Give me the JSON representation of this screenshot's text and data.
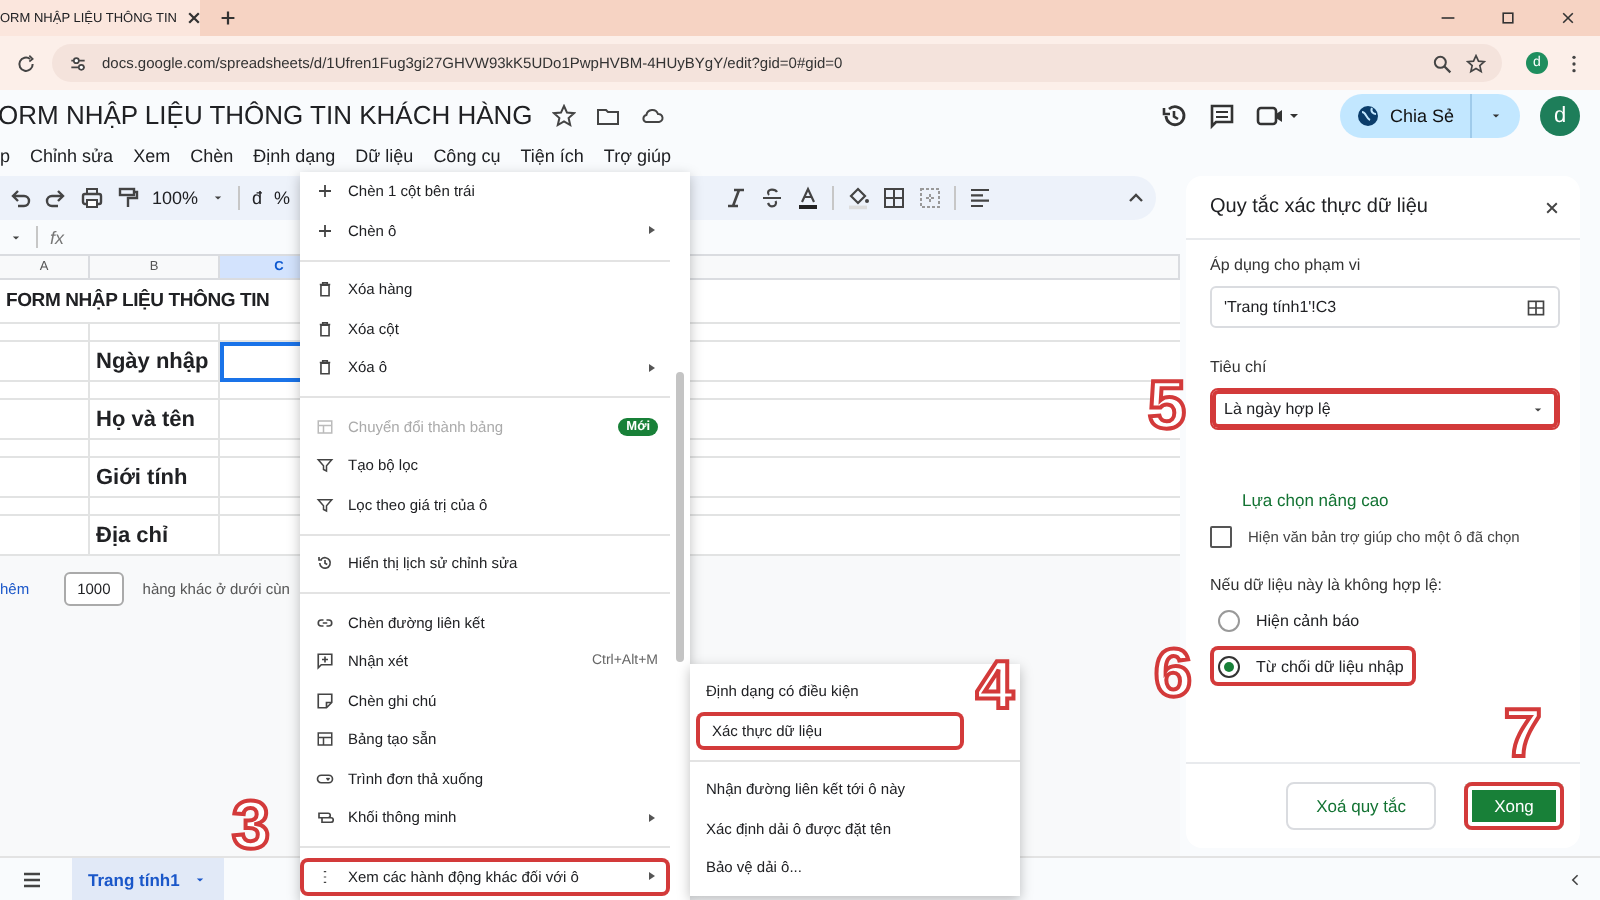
{
  "browser": {
    "tab_title": "ORM NHẬP LIỆU THÔNG TIN",
    "url": "docs.google.com/spreadsheets/d/1Ufren1Fug3gi27GHVW93kK5UDo1PwpHVBM-4HUyBYgY/edit?gid=0#gid=0",
    "profile": "d"
  },
  "doc": {
    "title": "ORM NHẬP LIỆU THÔNG TIN KHÁCH HÀNG",
    "share_label": "Chia Sẻ",
    "avatar": "d",
    "menus": [
      "p",
      "Chỉnh sửa",
      "Xem",
      "Chèn",
      "Định dạng",
      "Dữ liệu",
      "Công cụ",
      "Tiện ích",
      "Trợ giúp"
    ]
  },
  "toolbar": {
    "zoom": "100%",
    "currency": "đ",
    "percent": "%"
  },
  "formula_bar": {
    "fx": "fx"
  },
  "grid": {
    "columns": [
      {
        "label": "A",
        "selected": false
      },
      {
        "label": "B",
        "selected": false
      },
      {
        "label": "C",
        "selected": true
      }
    ],
    "title": "FORM NHẬP LIỆU THÔNG TIN",
    "rows": [
      {
        "label": "Ngày nhập",
        "active": true
      },
      {
        "label": "Họ và tên",
        "active": false
      },
      {
        "label": "Giới tính",
        "active": false
      },
      {
        "label": "Địa chỉ",
        "active": false
      }
    ]
  },
  "add_rows": {
    "link": "hêm",
    "count": "1000",
    "text": "hàng khác ở dưới cùn"
  },
  "sheets": [
    {
      "name": "Trang tính1",
      "selected": true
    }
  ],
  "context_menu": {
    "groups": [
      [
        {
          "label": "Chèn 1 cột bên trái",
          "submenu": false,
          "disabled": false,
          "highlighted": false
        },
        {
          "label": "Chèn ô",
          "submenu": true,
          "disabled": false,
          "highlighted": false
        }
      ],
      [
        {
          "label": "Xóa hàng",
          "submenu": false,
          "disabled": false,
          "highlighted": false
        },
        {
          "label": "Xóa cột",
          "submenu": false,
          "disabled": false,
          "highlighted": false
        },
        {
          "label": "Xóa ô",
          "submenu": true,
          "disabled": false,
          "highlighted": false
        }
      ],
      [
        {
          "label": "Chuyển đổi thành bảng",
          "submenu": false,
          "disabled": true,
          "highlighted": false,
          "badge": "Mới"
        },
        {
          "label": "Tạo bộ lọc",
          "submenu": false,
          "disabled": false,
          "highlighted": false
        },
        {
          "label": "Lọc theo giá trị của ô",
          "submenu": false,
          "disabled": false,
          "highlighted": false
        }
      ],
      [
        {
          "label": "Hiển thị lịch sử chỉnh sửa",
          "submenu": false,
          "disabled": false,
          "highlighted": false
        }
      ],
      [
        {
          "label": "Chèn đường liên kết",
          "submenu": false,
          "disabled": false,
          "highlighted": false
        },
        {
          "label": "Nhận xét",
          "submenu": false,
          "disabled": false,
          "highlighted": false,
          "shortcut": "Ctrl+Alt+M"
        },
        {
          "label": "Chèn ghi chú",
          "submenu": false,
          "disabled": false,
          "highlighted": false
        },
        {
          "label": "Bảng tạo sẵn",
          "submenu": false,
          "disabled": false,
          "highlighted": false
        },
        {
          "label": "Trình đơn thả xuống",
          "submenu": false,
          "disabled": false,
          "highlighted": false
        },
        {
          "label": "Khối thông minh",
          "submenu": true,
          "disabled": false,
          "highlighted": false
        }
      ],
      [
        {
          "label": "Xem các hành động khác đối với ô",
          "submenu": true,
          "disabled": false,
          "highlighted": true
        }
      ]
    ]
  },
  "submenu": {
    "groups": [
      [
        {
          "label": "Định dạng có điều kiện",
          "highlighted": false
        },
        {
          "label": "Xác thực dữ liệu",
          "highlighted": true
        }
      ],
      [
        {
          "label": "Nhận đường liên kết tới ô này",
          "highlighted": false
        },
        {
          "label": "Xác định dải ô được đặt tên",
          "highlighted": false
        },
        {
          "label": "Bảo vệ dải ô...",
          "highlighted": false
        }
      ]
    ]
  },
  "panel": {
    "title": "Quy tắc xác thực dữ liệu",
    "range_label": "Áp dụng cho phạm vi",
    "range_value": "'Trang tính1'!C3",
    "criteria_label": "Tiêu chí",
    "criteria": {
      "value": "Là ngày hợp lệ",
      "highlighted": true
    },
    "advanced_link": "Lựa chọn nâng cao",
    "help_option": {
      "label": "Hiện văn bản trợ giúp cho một ô đã chọn",
      "checked": false
    },
    "invalid_label": "Nếu dữ liệu này là không hợp lệ:",
    "invalid_options": [
      {
        "label": "Hiện cảnh báo",
        "selected": false,
        "highlighted": false
      },
      {
        "label": "Từ chối dữ liệu nhập",
        "selected": true,
        "highlighted": true
      }
    ],
    "buttons": [
      {
        "label": "Xoá quy tắc",
        "kind": "secondary",
        "highlighted": false
      },
      {
        "label": "Xong",
        "kind": "primary",
        "highlighted": true
      }
    ]
  },
  "annotations": [
    {
      "number": "3"
    },
    {
      "number": "4"
    },
    {
      "number": "5"
    },
    {
      "number": "6"
    },
    {
      "number": "7"
    }
  ]
}
